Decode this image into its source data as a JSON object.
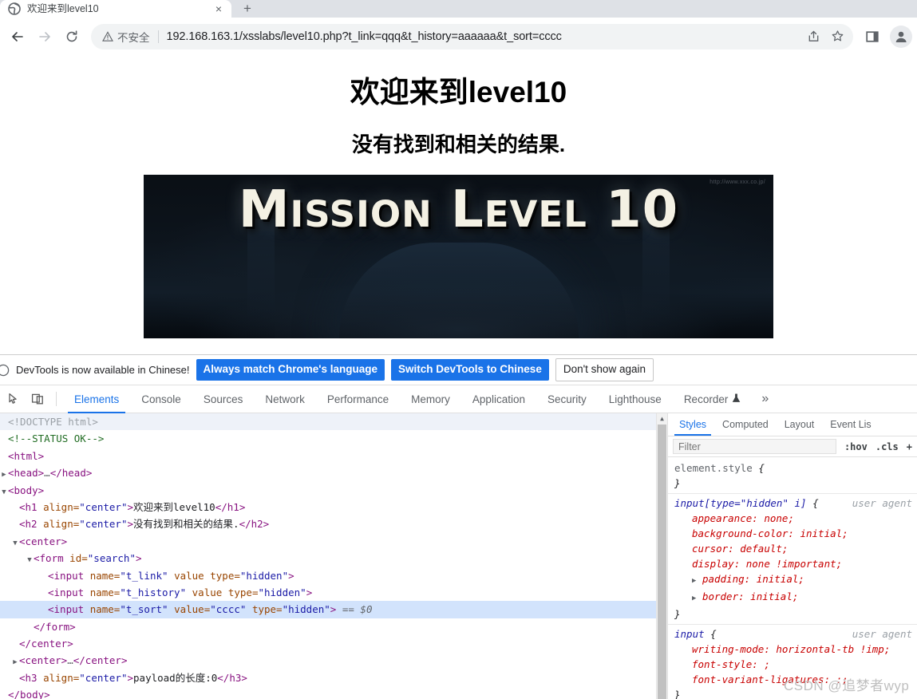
{
  "browser": {
    "tab": {
      "title": "欢迎来到level10",
      "favicon": "globe-icon",
      "close": "×"
    },
    "new_tab_label": "+",
    "nav": {
      "back": "←",
      "forward": "→",
      "reload": "⟳"
    },
    "omnibox": {
      "security_label": "不安全",
      "url": "192.168.163.1/xsslabs/level10.php?t_link=qqq&t_history=aaaaaa&t_sort=cccc",
      "share_icon": "share-icon",
      "bookmark_icon": "star-icon",
      "sidepanel_icon": "side-panel-icon",
      "profile_icon": "profile-avatar-icon"
    }
  },
  "page": {
    "h1": "欢迎来到level10",
    "h2": "没有找到和相关的结果.",
    "banner_text": "Mission Level 10",
    "banner_credit": "http://www.xxx.co.jp/"
  },
  "devtools": {
    "notice": {
      "text": "DevTools is now available in Chinese!",
      "buttons": [
        {
          "label": "Always match Chrome's language",
          "style": "primary"
        },
        {
          "label": "Switch DevTools to Chinese",
          "style": "primary"
        },
        {
          "label": "Don't show again",
          "style": "plain"
        }
      ]
    },
    "toolbar_icons": [
      "inspect-element-icon",
      "device-toolbar-icon"
    ],
    "tabs": [
      {
        "label": "Elements",
        "active": true
      },
      {
        "label": "Console",
        "active": false
      },
      {
        "label": "Sources",
        "active": false
      },
      {
        "label": "Network",
        "active": false
      },
      {
        "label": "Performance",
        "active": false
      },
      {
        "label": "Memory",
        "active": false
      },
      {
        "label": "Application",
        "active": false
      },
      {
        "label": "Security",
        "active": false
      },
      {
        "label": "Lighthouse",
        "active": false
      },
      {
        "label": "Recorder",
        "active": false,
        "icon": "flask-icon"
      }
    ],
    "more_tabs": "»",
    "dom": [
      {
        "indent": 0,
        "twisty": "none",
        "type": "doctype",
        "text": "<!DOCTYPE html>"
      },
      {
        "indent": 0,
        "twisty": "none",
        "type": "comment",
        "text": "<!--STATUS OK-->"
      },
      {
        "indent": 0,
        "twisty": "none",
        "type": "tag",
        "tag": "html",
        "close": false
      },
      {
        "indent": 0,
        "twisty": "closed",
        "type": "collapsed",
        "tag": "head"
      },
      {
        "indent": 0,
        "twisty": "open",
        "type": "tag",
        "tag": "body",
        "close": false
      },
      {
        "indent": 1,
        "twisty": "none",
        "type": "element",
        "tag": "h1",
        "attr": "align",
        "value": "center",
        "text": "欢迎来到level10"
      },
      {
        "indent": 1,
        "twisty": "none",
        "type": "element",
        "tag": "h2",
        "attr": "align",
        "value": "center",
        "text": "没有找到和相关的结果."
      },
      {
        "indent": 1,
        "twisty": "open",
        "type": "tag",
        "tag": "center",
        "close": false
      },
      {
        "indent": 2,
        "twisty": "open",
        "type": "voidtag",
        "tag": "form",
        "attrs": [
          {
            "n": "id",
            "v": "search"
          }
        ]
      },
      {
        "indent": 3,
        "twisty": "none",
        "type": "voidtag",
        "tag": "input",
        "attrs": [
          {
            "n": "name",
            "v": "t_link"
          },
          {
            "n": "value",
            "v": null
          },
          {
            "n": "type",
            "v": "hidden"
          }
        ]
      },
      {
        "indent": 3,
        "twisty": "none",
        "type": "voidtag",
        "tag": "input",
        "attrs": [
          {
            "n": "name",
            "v": "t_history"
          },
          {
            "n": "value",
            "v": null
          },
          {
            "n": "type",
            "v": "hidden"
          }
        ]
      },
      {
        "indent": 3,
        "twisty": "none",
        "type": "voidtag",
        "tag": "input",
        "attrs": [
          {
            "n": "name",
            "v": "t_sort"
          },
          {
            "n": "value",
            "v": "cccc"
          },
          {
            "n": "type",
            "v": "hidden"
          }
        ],
        "selected": true,
        "suffix": "== $0"
      },
      {
        "indent": 2,
        "twisty": "none",
        "type": "tag",
        "tag": "form",
        "close": true
      },
      {
        "indent": 1,
        "twisty": "none",
        "type": "tag",
        "tag": "center",
        "close": true
      },
      {
        "indent": 1,
        "twisty": "closed",
        "type": "collapsed",
        "tag": "center"
      },
      {
        "indent": 1,
        "twisty": "none",
        "type": "element",
        "tag": "h3",
        "attr": "align",
        "value": "center",
        "text": "payload的长度:0"
      },
      {
        "indent": 0,
        "twisty": "none",
        "type": "tag",
        "tag": "body",
        "close": true
      }
    ],
    "styles": {
      "tabs": [
        {
          "label": "Styles",
          "active": true
        },
        {
          "label": "Computed",
          "active": false
        },
        {
          "label": "Layout",
          "active": false
        },
        {
          "label": "Event Lis",
          "active": false
        }
      ],
      "filter_placeholder": "Filter",
      "toggles": [
        ":hov",
        ".cls"
      ],
      "rules": [
        {
          "selector": "element.style",
          "origin": "",
          "ua": false,
          "decls": []
        },
        {
          "selector": "input[type=\"hidden\" i]",
          "origin": "user agent",
          "ua": true,
          "decls": [
            {
              "prop": "appearance",
              "value": "none",
              "expand": false
            },
            {
              "prop": "background-color",
              "value": "initial",
              "expand": false
            },
            {
              "prop": "cursor",
              "value": "default",
              "expand": false
            },
            {
              "prop": "display",
              "value": "none !important",
              "expand": false
            },
            {
              "prop": "padding",
              "value": "initial",
              "expand": true
            },
            {
              "prop": "border",
              "value": "initial",
              "expand": true
            }
          ]
        },
        {
          "selector": "input",
          "origin": "user agent",
          "ua": true,
          "decls": [
            {
              "prop": "writing-mode",
              "value": "horizontal-tb !imp",
              "expand": false
            },
            {
              "prop": "font-style",
              "value": "",
              "expand": false
            },
            {
              "prop": "font-variant-ligatures",
              "value": ":",
              "expand": false
            }
          ]
        }
      ]
    }
  },
  "watermark": {
    "text": "CSDN @追梦者wyp"
  },
  "colors": {
    "accent": "#1a73e8",
    "tab_strip": "#dee1e6",
    "omnibox_bg": "#f1f3f4",
    "selected_row": "#d2e3fc",
    "tag": "#881280",
    "attr_name": "#994500",
    "attr_value": "#1a1aa6",
    "comment": "#236e25",
    "declaration": "#c80000"
  }
}
